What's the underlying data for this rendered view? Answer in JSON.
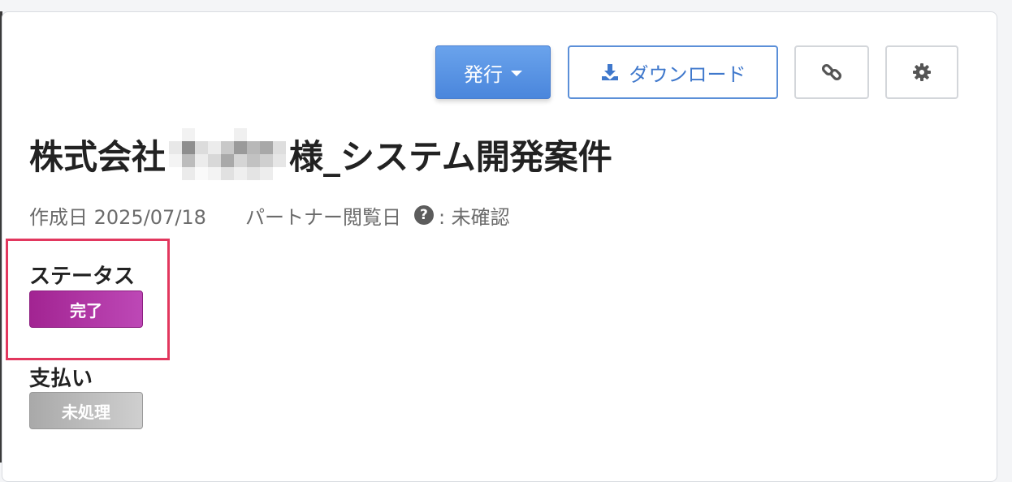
{
  "toolbar": {
    "issue_label": "発行",
    "download_label": "ダウンロード",
    "link_icon": "link-icon",
    "settings_icon": "gear-icon",
    "download_icon": "download-icon"
  },
  "title": {
    "prefix": "株式会社",
    "suffix": "様_システム開発案件"
  },
  "meta": {
    "created_label": "作成日 2025/07/18",
    "partner_viewed_label": "パートナー閲覧日",
    "partner_viewed_value": ": 未確認"
  },
  "status": {
    "label": "ステータス",
    "value": "完了",
    "color": "#b03aa5"
  },
  "payment": {
    "label": "支払い",
    "value": "未処理",
    "color": "#bbbbbb"
  },
  "colors": {
    "primary": "#4a86dc",
    "highlight": "#e2375e"
  }
}
